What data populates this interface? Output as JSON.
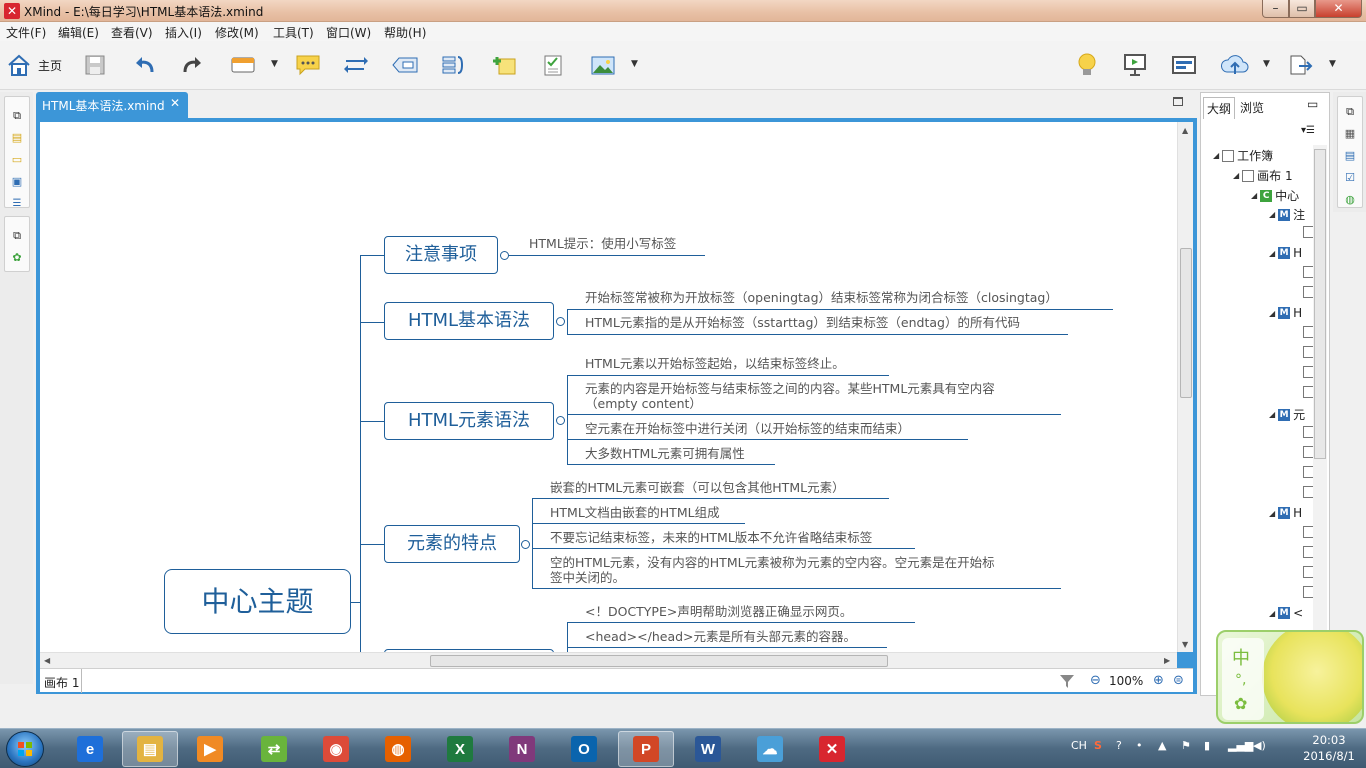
{
  "window": {
    "title": "XMind - E:\\每日学习\\HTML基本语法.xmind",
    "app_icon": "✕"
  },
  "menu": [
    "文件(F)",
    "编辑(E)",
    "查看(V)",
    "插入(I)",
    "修改(M)",
    "工具(T)",
    "窗口(W)",
    "帮助(H)"
  ],
  "toolbar": {
    "home_label": "主页",
    "icons": [
      "home-icon",
      "save-icon",
      "undo-icon",
      "redo-icon",
      "insert-topic-icon",
      "callout-icon",
      "relationship-icon",
      "boundary-icon",
      "summary-icon",
      "add-note-icon",
      "task-icon",
      "image-icon",
      "idea-bulb-icon",
      "presentation-icon",
      "layout-icon",
      "upload-icon",
      "export-icon"
    ]
  },
  "editor": {
    "tab_label": "HTML基本语法.xmind",
    "sheet_tab": "画布 1",
    "zoom": "100%"
  },
  "mindmap": {
    "central": "中心主题",
    "topics": [
      {
        "title": "注意事项",
        "details": [
          "HTML提示：使用小写标签"
        ]
      },
      {
        "title": "HTML基本语法",
        "details": [
          "开始标签常被称为开放标签（openingtag）结束标签常称为闭合标签（closingtag）",
          "HTML元素指的是从开始标签（sstarttag）到结束标签（endtag）的所有代码"
        ]
      },
      {
        "title": "HTML元素语法",
        "details": [
          "HTML元素以开始标签起始，以结束标签终止。",
          "元素的内容是开始标签与结束标签之间的内容。某些HTML元素具有空内容",
          "（empty content）",
          "空元素在开始标签中进行关闭（以开始标签的结束而结束）",
          "大多数HTML元素可拥有属性"
        ]
      },
      {
        "title": "元素的特点",
        "details": [
          "嵌套的HTML元素可嵌套（可以包含其他HTML元素）",
          "HTML文档由嵌套的HTML组成",
          "不要忘记结束标签，未来的HTML版本不允许省略结束标签",
          "空的HTML元素，没有内容的HTML元素被称为元素的空内容。空元素是在开始标",
          "签中关闭的。"
        ]
      },
      {
        "title": "",
        "details": [
          "<！DOCTYPE>声明帮助浏览器正确显示网页。",
          "<head></head>元素是所有头部元素的容器。"
        ]
      }
    ]
  },
  "outline": {
    "tabs": [
      "大纲",
      "浏览"
    ],
    "workbook": "工作簿",
    "sheet": "画布 1",
    "central": "中心",
    "topic_initials": [
      "注",
      "H",
      "H",
      "元",
      "H",
      "<"
    ]
  },
  "ime": {
    "char": "中"
  },
  "taskbar": {
    "apps": [
      {
        "name": "ie",
        "glyph": "e",
        "color": "#1e6fd9"
      },
      {
        "name": "explorer",
        "glyph": "▤",
        "color": "#e3b341"
      },
      {
        "name": "media",
        "glyph": "▶",
        "color": "#f08a24"
      },
      {
        "name": "sync",
        "glyph": "⇄",
        "color": "#69b43c"
      },
      {
        "name": "chrome",
        "glyph": "◉",
        "color": "#dd4b39"
      },
      {
        "name": "firefox",
        "glyph": "◍",
        "color": "#e66000"
      },
      {
        "name": "excel",
        "glyph": "X",
        "color": "#1f7a3f"
      },
      {
        "name": "onenote",
        "glyph": "N",
        "color": "#80397b"
      },
      {
        "name": "outlook",
        "glyph": "O",
        "color": "#0a64ad"
      },
      {
        "name": "powerpoint",
        "glyph": "P",
        "color": "#d24726"
      },
      {
        "name": "word",
        "glyph": "W",
        "color": "#2b5797"
      },
      {
        "name": "cloud",
        "glyph": "☁",
        "color": "#4a9fd8"
      },
      {
        "name": "xmind",
        "glyph": "✕",
        "color": "#d8262f"
      }
    ],
    "tray": {
      "lang": "CH"
    },
    "clock": {
      "time": "20:03",
      "date": "2016/8/1"
    }
  }
}
